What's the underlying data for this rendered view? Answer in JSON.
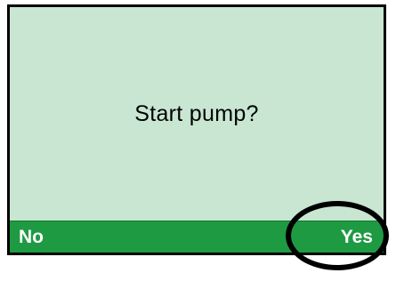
{
  "screen": {
    "prompt": "Start pump?"
  },
  "softkeys": {
    "left_label": "No",
    "right_label": "Yes"
  },
  "colors": {
    "screen_background": "#c8e6d2",
    "softkey_bar": "#1e9a43",
    "softkey_text": "#ffffff",
    "highlight_ring": "#000000"
  }
}
